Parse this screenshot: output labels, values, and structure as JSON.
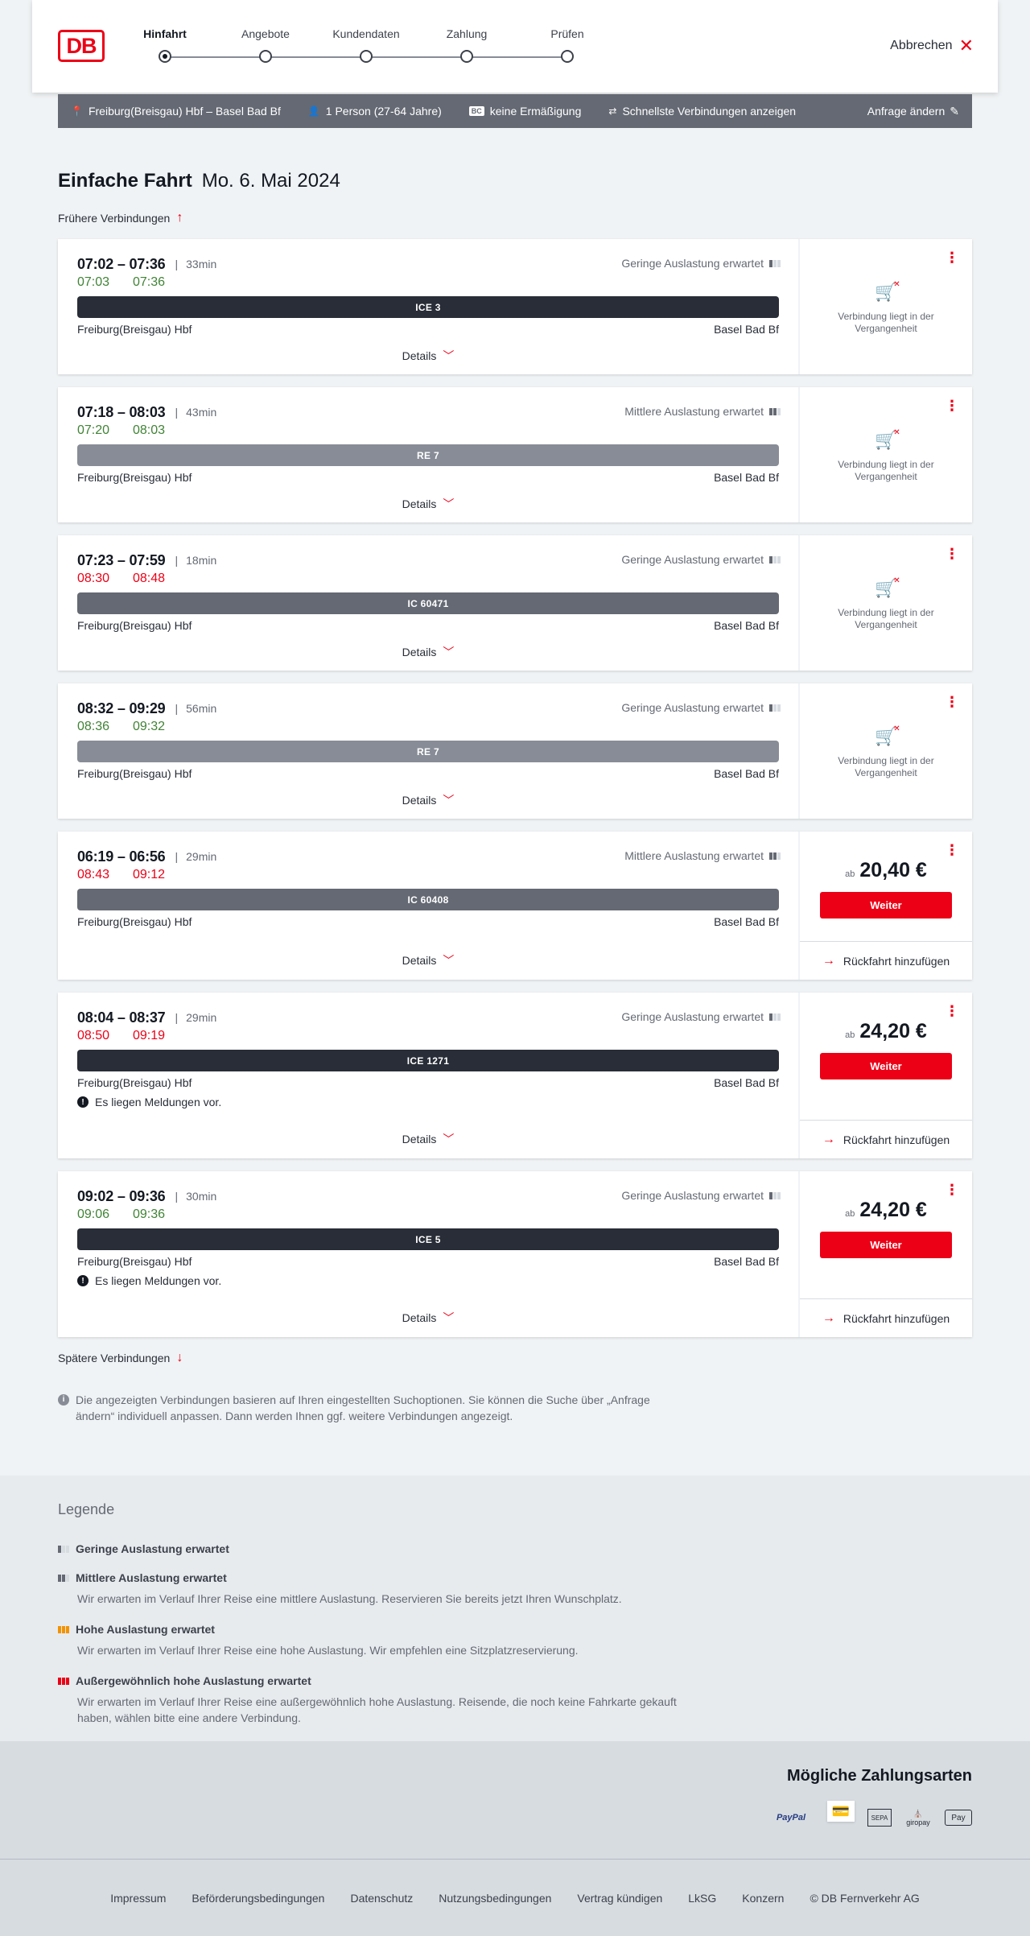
{
  "header": {
    "logo": "DB",
    "steps": [
      {
        "label": "Hinfahrt",
        "active": true
      },
      {
        "label": "Angebote",
        "active": false
      },
      {
        "label": "Kundendaten",
        "active": false
      },
      {
        "label": "Zahlung",
        "active": false
      },
      {
        "label": "Prüfen",
        "active": false
      }
    ],
    "cancel_label": "Abbrechen"
  },
  "query": {
    "route": "Freiburg(Breisgau) Hbf – Basel Bad Bf",
    "travelers": "1 Person (27-64 Jahre)",
    "discount_badge": "BC",
    "discount": "keine Ermäßigung",
    "fastest": "Schnellste Verbindungen anzeigen",
    "change": "Anfrage ändern"
  },
  "page": {
    "title": "Einfache Fahrt",
    "date": "Mo. 6. Mai 2024",
    "earlier": "Frühere Verbindungen",
    "later": "Spätere Verbindungen",
    "note": "Die angezeigten Verbindungen basieren auf Ihren eingestellten Suchoptionen. Sie können die Suche über „Anfrage ändern“ individuell anpassen. Dann werden Ihnen ggf. weitere Verbindungen angezeigt."
  },
  "common": {
    "details": "Details",
    "past": "Verbindung liegt in der Vergangenheit",
    "price_prefix": "ab",
    "continue": "Weiter",
    "return_trip": "Rückfahrt hinzufügen",
    "notice": "Es liegen Meldungen vor."
  },
  "connections": [
    {
      "times": "07:02 – 07:36",
      "duration": "33min",
      "load": "Geringe Auslastung erwartet",
      "rt_dep": "07:03",
      "rt_arr": "07:36",
      "rt_dep_late": false,
      "rt_arr_late": false,
      "train": "ICE 3",
      "train_type": "ice",
      "from": "Freiburg(Breisgau) Hbf",
      "to": "Basel Bad Bf",
      "past": true
    },
    {
      "times": "07:18 – 08:03",
      "duration": "43min",
      "load": "Mittlere Auslastung erwartet",
      "rt_dep": "07:20",
      "rt_arr": "08:03",
      "rt_dep_late": false,
      "rt_arr_late": false,
      "train": "RE 7",
      "train_type": "re",
      "from": "Freiburg(Breisgau) Hbf",
      "to": "Basel Bad Bf",
      "past": true
    },
    {
      "times": "07:23 – 07:59",
      "duration": "18min",
      "load": "Geringe Auslastung erwartet",
      "rt_dep": "08:30",
      "rt_arr": "08:48",
      "rt_dep_late": true,
      "rt_arr_late": true,
      "train": "IC 60471",
      "train_type": "ic",
      "from": "Freiburg(Breisgau) Hbf",
      "to": "Basel Bad Bf",
      "past": true
    },
    {
      "times": "08:32 – 09:29",
      "duration": "56min",
      "load": "Geringe Auslastung erwartet",
      "rt_dep": "08:36",
      "rt_arr": "09:32",
      "rt_dep_late": false,
      "rt_arr_late": false,
      "train": "RE 7",
      "train_type": "re",
      "from": "Freiburg(Breisgau) Hbf",
      "to": "Basel Bad Bf",
      "past": true
    },
    {
      "times": "06:19 – 06:56",
      "duration": "29min",
      "load": "Mittlere Auslastung erwartet",
      "rt_dep": "08:43",
      "rt_arr": "09:12",
      "rt_dep_late": true,
      "rt_arr_late": true,
      "train": "IC 60408",
      "train_type": "ic",
      "from": "Freiburg(Breisgau) Hbf",
      "to": "Basel Bad Bf",
      "past": false,
      "price": "20,40 €"
    },
    {
      "times": "08:04 – 08:37",
      "duration": "29min",
      "load": "Geringe Auslastung erwartet",
      "rt_dep": "08:50",
      "rt_arr": "09:19",
      "rt_dep_late": true,
      "rt_arr_late": true,
      "train": "ICE 1271",
      "train_type": "ice",
      "from": "Freiburg(Breisgau) Hbf",
      "to": "Basel Bad Bf",
      "past": false,
      "price": "24,20 €",
      "notice": true
    },
    {
      "times": "09:02 – 09:36",
      "duration": "30min",
      "load": "Geringe Auslastung erwartet",
      "rt_dep": "09:06",
      "rt_arr": "09:36",
      "rt_dep_late": false,
      "rt_arr_late": false,
      "train": "ICE 5",
      "train_type": "ice",
      "from": "Freiburg(Breisgau) Hbf",
      "to": "Basel Bad Bf",
      "past": false,
      "price": "24,20 €",
      "notice": true
    }
  ],
  "legend": {
    "title": "Legende",
    "items": [
      {
        "title": "Geringe Auslastung erwartet",
        "desc": ""
      },
      {
        "title": "Mittlere Auslastung erwartet",
        "desc": "Wir erwarten im Verlauf Ihrer Reise eine mittlere Auslastung. Reservieren Sie bereits jetzt Ihren Wunschplatz."
      },
      {
        "title": "Hohe Auslastung erwartet",
        "desc": "Wir erwarten im Verlauf Ihrer Reise eine hohe Auslastung. Wir empfehlen eine Sitzplatzreservierung."
      },
      {
        "title": "Außergewöhnlich hohe Auslastung erwartet",
        "desc": "Wir erwarten im Verlauf Ihrer Reise eine außergewöhnlich hohe Auslastung. Reisende, die noch keine Fahrkarte gekauft haben, wählen bitte eine andere Verbindung."
      }
    ]
  },
  "payment": {
    "title": "Mögliche Zahlungsarten",
    "methods": [
      "PayPal",
      "SEPA",
      "giropay",
      "Pay"
    ]
  },
  "footer": {
    "links": [
      "Impressum",
      "Beförderungsbedingungen",
      "Datenschutz",
      "Nutzungsbedingungen",
      "Vertrag kündigen",
      "LkSG",
      "Konzern"
    ],
    "copyright": "© DB Fernverkehr AG"
  },
  "colors": {
    "accent": "#ec0016",
    "on_time": "#408335",
    "delay": "#ec0016"
  }
}
